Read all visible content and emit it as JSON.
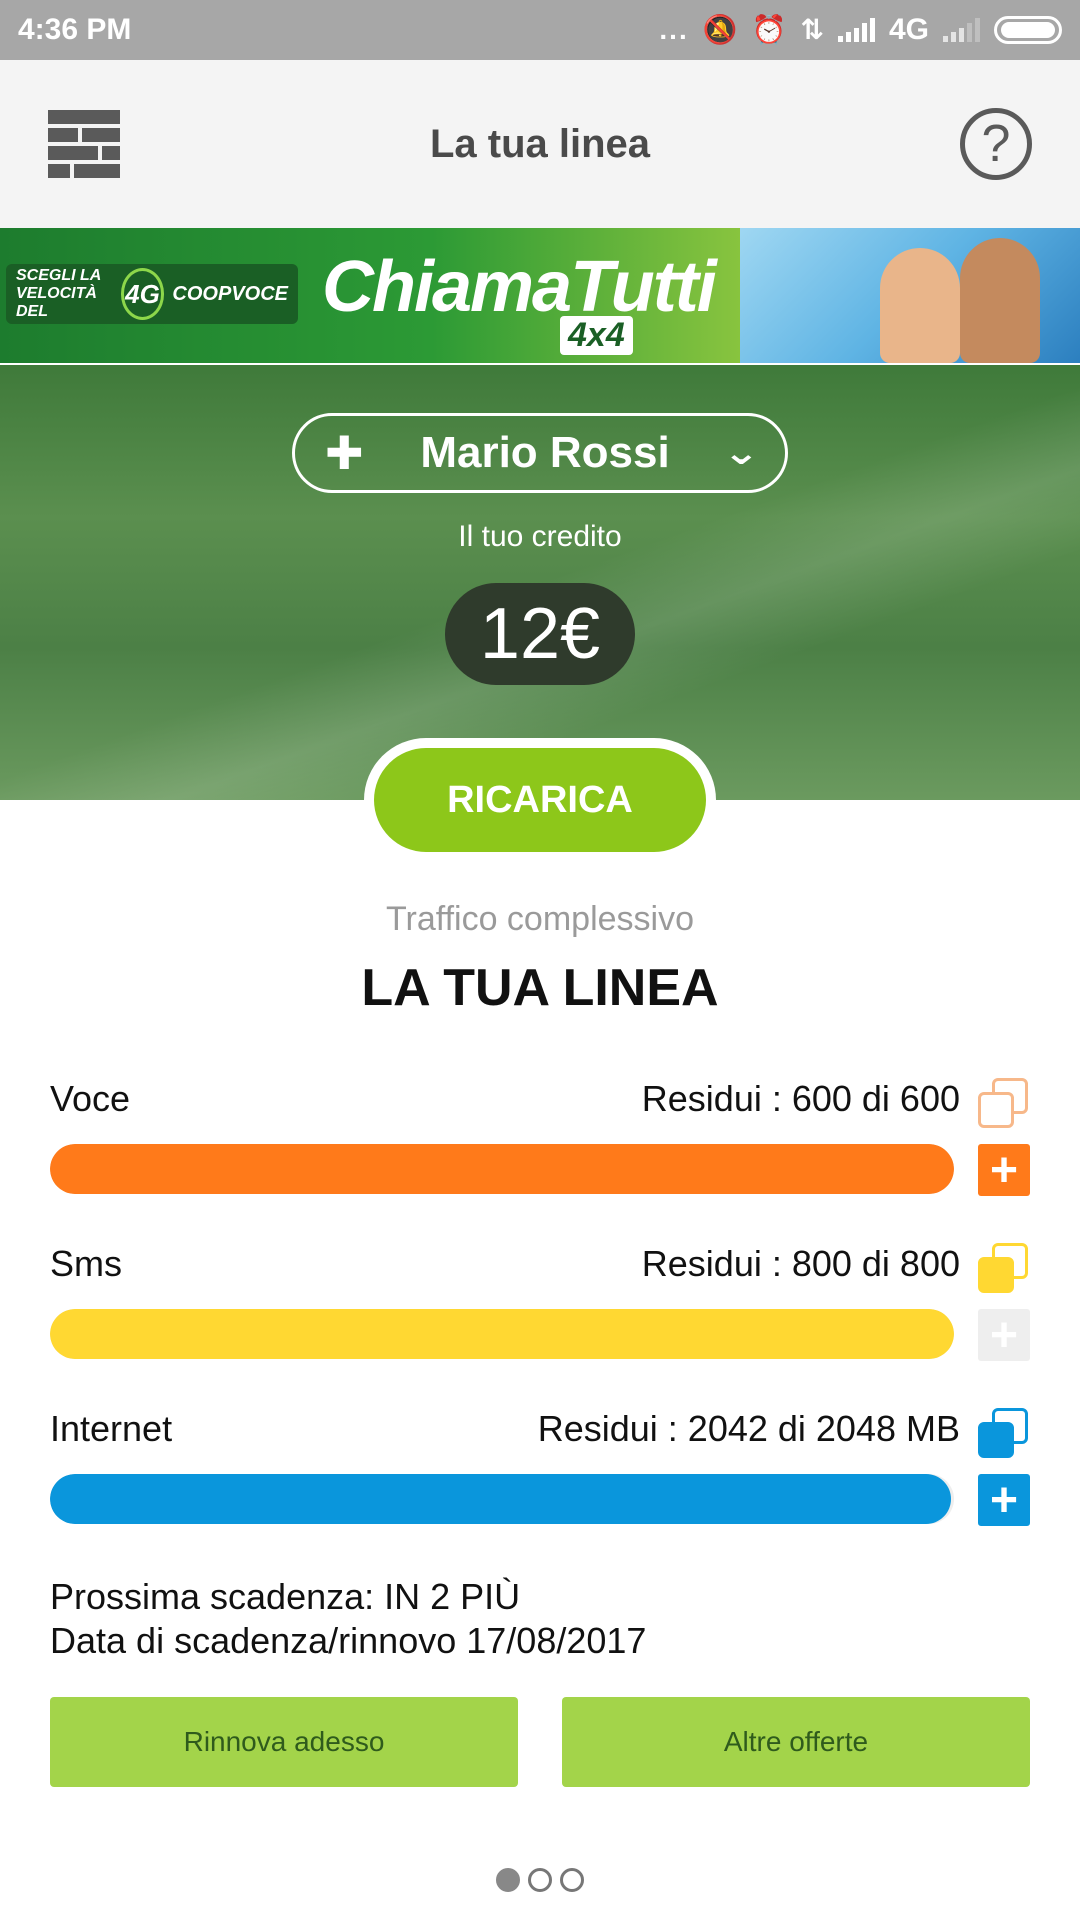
{
  "status_bar": {
    "time": "4:36 PM",
    "dots": "...",
    "network": "4G",
    "icons": [
      "mute-icon",
      "alarm-icon",
      "data-arrows-icon",
      "signal-icon",
      "signal-icon-2",
      "battery-icon"
    ]
  },
  "app_bar": {
    "title": "La tua linea",
    "menu_icon": "bricks-menu-icon",
    "help_icon": "help-icon",
    "help_glyph": "?"
  },
  "banner": {
    "left_text_1": "SCEGLI LA",
    "left_text_2": "VELOCITÀ DEL",
    "badge": "4G",
    "coop": "COOPVOCE",
    "brand": "ChiamaTutti",
    "sub": "4x4"
  },
  "account": {
    "plus": "✚",
    "name": "Mario Rossi",
    "chevron": "⌄",
    "credit_label": "Il tuo credito",
    "credit": "12€",
    "recharge": "RICARICA"
  },
  "traffic": {
    "subtitle": "Traffico complessivo",
    "title": "LA TUA LINEA",
    "items": [
      {
        "label": "Voce",
        "remaining": "Residui : 600 di 600",
        "fraction": 1.0,
        "color": "#ff7a1a",
        "add_color": "#ff7a1a",
        "copy_back": "#f7b88a",
        "copy_front": "#ffffff"
      },
      {
        "label": "Sms",
        "remaining": "Residui : 800 di 800",
        "fraction": 1.0,
        "color": "#ffd832",
        "add_color": "#eeeeee",
        "copy_back": "#ffd832",
        "copy_front": "#ffd832"
      },
      {
        "label": "Internet",
        "remaining": "Residui : 2042 di 2048 MB",
        "fraction": 0.997,
        "color": "#0a96dc",
        "add_color": "#0a96dc",
        "copy_back": "#0a96dc",
        "copy_front": "#0a96dc"
      }
    ],
    "add_glyph": "+"
  },
  "expiry": {
    "next": "Prossima scadenza: IN 2 PIÙ",
    "date": "Data di scadenza/rinnovo 17/08/2017"
  },
  "actions": {
    "renew": "Rinnova adesso",
    "offers": "Altre offerte"
  },
  "pager": {
    "pages": 3,
    "current": 1
  },
  "colors": {
    "accent_green": "#8dc71a",
    "button_green": "#a3d44a",
    "status_bar": "#a7a7a7"
  }
}
